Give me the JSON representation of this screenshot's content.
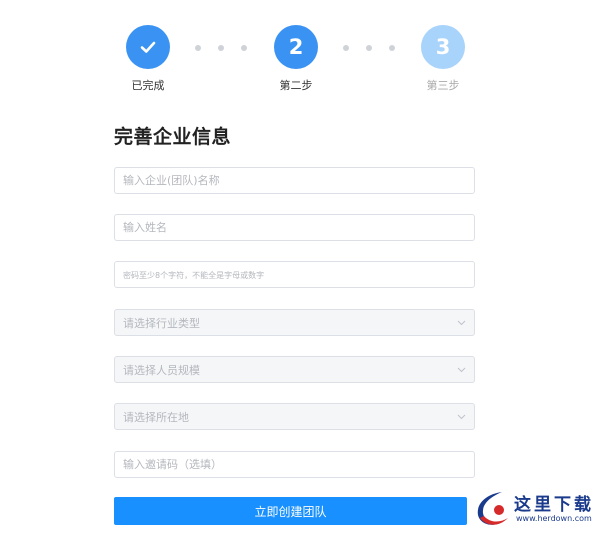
{
  "stepper": {
    "steps": [
      {
        "label": "已完成",
        "number": "",
        "status": "completed",
        "icon": "check-icon",
        "color": "#3a93f2"
      },
      {
        "label": "第二步",
        "number": "2",
        "status": "active",
        "color": "#3a93f2"
      },
      {
        "label": "第三步",
        "number": "3",
        "status": "pending",
        "color": "#a8d3fa"
      }
    ]
  },
  "form": {
    "title": "完善企业信息",
    "company_name_placeholder": "输入企业(团队)名称",
    "full_name_placeholder": "输入姓名",
    "password_placeholder": "密码至少8个字符，不能全是字母或数字",
    "industry_select": "请选择行业类型",
    "staff_size_select": "请选择人员规模",
    "location_select": "请选择所在地",
    "invite_code_placeholder": "输入邀请码（选填）",
    "submit_label": "立即创建团队",
    "accent_color": "#1890ff"
  },
  "watermark": {
    "text": "这里下载",
    "url": "www.herdown.com"
  }
}
